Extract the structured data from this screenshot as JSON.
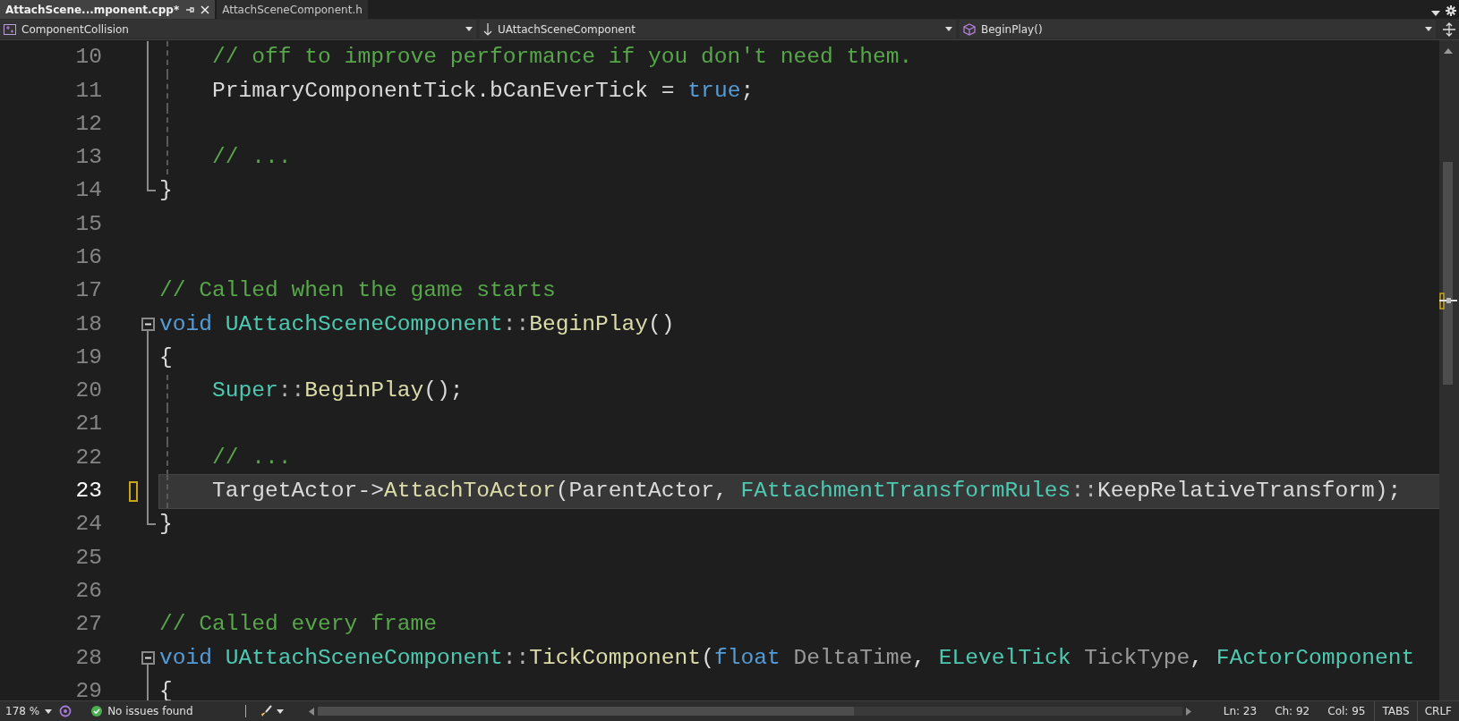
{
  "tabs": [
    {
      "label": "AttachScene...mponent.cpp*",
      "selected": true
    },
    {
      "label": "AttachSceneComponent.h",
      "selected": false
    }
  ],
  "nav_bar": [
    {
      "kind": "project",
      "label": "ComponentCollision"
    },
    {
      "kind": "scope",
      "label": "UAttachSceneComponent"
    },
    {
      "kind": "member",
      "label": "BeginPlay()"
    }
  ],
  "lines": [
    {
      "number": "10",
      "fold_start": false,
      "fold_body": true,
      "fold_end": false,
      "guide": true,
      "changed": false,
      "current": false,
      "tokens": [
        {
          "text": "    // off to improve performance if you don't need them.",
          "kind": "comment"
        }
      ]
    },
    {
      "number": "11",
      "fold_start": false,
      "fold_body": true,
      "fold_end": false,
      "guide": true,
      "changed": false,
      "current": false,
      "tokens": [
        {
          "text": "    PrimaryComponentTick.bCanEverTick = ",
          "kind": "plain"
        },
        {
          "text": "true",
          "kind": "keyword"
        },
        {
          "text": ";",
          "kind": "plain"
        }
      ]
    },
    {
      "number": "12",
      "fold_start": false,
      "fold_body": true,
      "fold_end": false,
      "guide": true,
      "changed": false,
      "current": false
    },
    {
      "number": "13",
      "fold_start": false,
      "fold_body": true,
      "fold_end": false,
      "guide": true,
      "changed": false,
      "current": false,
      "tokens": [
        {
          "text": "    // ...",
          "kind": "comment"
        }
      ]
    },
    {
      "number": "14",
      "fold_start": false,
      "fold_body": false,
      "fold_end": true,
      "guide": false,
      "changed": false,
      "current": false,
      "tokens": [
        {
          "text": "}",
          "kind": "plain"
        }
      ]
    },
    {
      "number": "15",
      "fold_start": false,
      "fold_body": false,
      "fold_end": false,
      "guide": false,
      "changed": false,
      "current": false
    },
    {
      "number": "16",
      "fold_start": false,
      "fold_body": false,
      "fold_end": false,
      "guide": false,
      "changed": false,
      "current": false
    },
    {
      "number": "17",
      "fold_start": false,
      "fold_body": false,
      "fold_end": false,
      "guide": false,
      "changed": false,
      "current": false,
      "tokens": [
        {
          "text": "// Called when the game starts",
          "kind": "comment"
        }
      ]
    },
    {
      "number": "18",
      "fold_start": true,
      "fold_body": false,
      "fold_end": false,
      "guide": false,
      "changed": false,
      "current": false,
      "tokens": [
        {
          "text": "void ",
          "kind": "keyword"
        },
        {
          "text": "UAttachSceneComponent",
          "kind": "type"
        },
        {
          "text": "::",
          "kind": "op"
        },
        {
          "text": "BeginPlay",
          "kind": "func"
        },
        {
          "text": "()",
          "kind": "plain"
        }
      ]
    },
    {
      "number": "19",
      "fold_start": false,
      "fold_body": true,
      "fold_end": false,
      "guide": false,
      "changed": false,
      "current": false,
      "tokens": [
        {
          "text": "{",
          "kind": "plain"
        }
      ]
    },
    {
      "number": "20",
      "fold_start": false,
      "fold_body": true,
      "fold_end": false,
      "guide": true,
      "changed": false,
      "current": false,
      "tokens": [
        {
          "text": "    Super",
          "kind": "type"
        },
        {
          "text": "::",
          "kind": "op"
        },
        {
          "text": "BeginPlay",
          "kind": "func"
        },
        {
          "text": "();",
          "kind": "plain"
        }
      ]
    },
    {
      "number": "21",
      "fold_start": false,
      "fold_body": true,
      "fold_end": false,
      "guide": true,
      "changed": false,
      "current": false
    },
    {
      "number": "22",
      "fold_start": false,
      "fold_body": true,
      "fold_end": false,
      "guide": true,
      "changed": false,
      "current": false,
      "tokens": [
        {
          "text": "    // ...",
          "kind": "comment"
        }
      ]
    },
    {
      "number": "23",
      "fold_start": false,
      "fold_body": true,
      "fold_end": false,
      "guide": true,
      "changed": true,
      "current": true,
      "tokens": [
        {
          "text": "    TargetActor->",
          "kind": "plain"
        },
        {
          "text": "AttachToActor",
          "kind": "func"
        },
        {
          "text": "(ParentActor, ",
          "kind": "plain"
        },
        {
          "text": "FAttachmentTransformRules",
          "kind": "type"
        },
        {
          "text": "::",
          "kind": "op"
        },
        {
          "text": "KeepRelativeTransform",
          "kind": "plain"
        },
        {
          "text": ");",
          "kind": "plain"
        }
      ]
    },
    {
      "number": "24",
      "fold_start": false,
      "fold_body": false,
      "fold_end": true,
      "guide": false,
      "changed": false,
      "current": false,
      "tokens": [
        {
          "text": "}",
          "kind": "plain"
        }
      ]
    },
    {
      "number": "25",
      "fold_start": false,
      "fold_body": false,
      "fold_end": false,
      "guide": false,
      "changed": false,
      "current": false
    },
    {
      "number": "26",
      "fold_start": false,
      "fold_body": false,
      "fold_end": false,
      "guide": false,
      "changed": false,
      "current": false
    },
    {
      "number": "27",
      "fold_start": false,
      "fold_body": false,
      "fold_end": false,
      "guide": false,
      "changed": false,
      "current": false,
      "tokens": [
        {
          "text": "// Called every frame",
          "kind": "comment"
        }
      ]
    },
    {
      "number": "28",
      "fold_start": true,
      "fold_body": false,
      "fold_end": false,
      "guide": false,
      "changed": false,
      "current": false,
      "tokens": [
        {
          "text": "void ",
          "kind": "keyword"
        },
        {
          "text": "UAttachSceneComponent",
          "kind": "type"
        },
        {
          "text": "::",
          "kind": "op"
        },
        {
          "text": "TickComponent",
          "kind": "func"
        },
        {
          "text": "(",
          "kind": "plain"
        },
        {
          "text": "float ",
          "kind": "keyword"
        },
        {
          "text": "DeltaTime",
          "kind": "param"
        },
        {
          "text": ", ",
          "kind": "plain"
        },
        {
          "text": "ELevelTick ",
          "kind": "type"
        },
        {
          "text": "TickType",
          "kind": "param"
        },
        {
          "text": ", ",
          "kind": "plain"
        },
        {
          "text": "FActorComponent",
          "kind": "type"
        }
      ]
    },
    {
      "number": "29",
      "fold_start": false,
      "fold_body": true,
      "fold_end": false,
      "guide": false,
      "changed": false,
      "current": false,
      "tokens": [
        {
          "text": "{",
          "kind": "plain"
        }
      ]
    }
  ],
  "status_bar": {
    "zoom": "178 %",
    "issues": "No issues found",
    "line": "Ln: 23",
    "char": "Ch: 92",
    "col": "Col: 95",
    "indent": "TABS",
    "line_ending": "CRLF"
  }
}
